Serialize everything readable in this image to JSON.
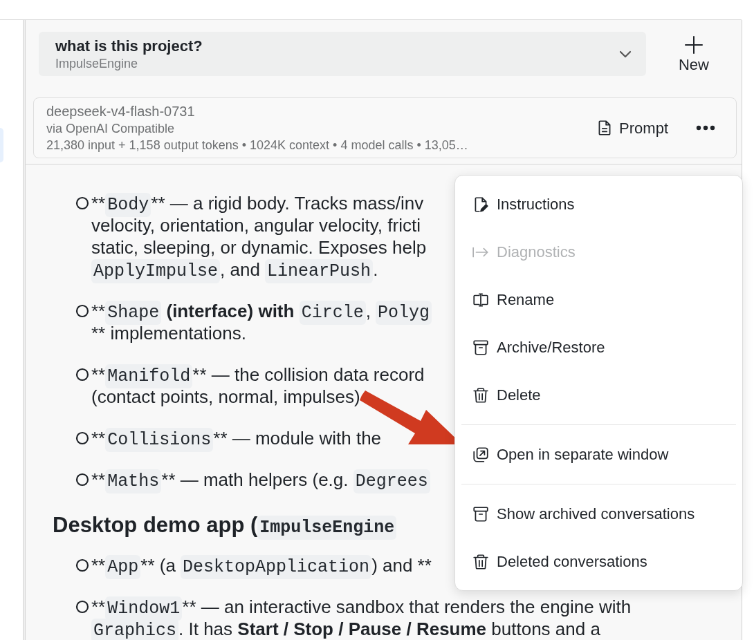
{
  "header": {
    "title": "what is this project?",
    "subtitle": "ImpulseEngine",
    "new_button": "New"
  },
  "model_card": {
    "model": "deepseek-v4-flash-0731",
    "provider": "via OpenAI Compatible",
    "stats": "21,380 input + 1,158 output tokens • 1024K context • 4 model calls • 13,05…",
    "prompt_button": "Prompt"
  },
  "content": [
    {
      "kind": "item",
      "lines": [
        [
          {
            "kind": "text",
            "text": "**"
          },
          {
            "kind": "code",
            "text": "Body"
          },
          {
            "kind": "text",
            "text": "** — a rigid body. Tracks mass/inv"
          }
        ],
        [
          {
            "kind": "text",
            "text": "velocity, orientation, angular velocity, fricti"
          }
        ],
        [
          {
            "kind": "text",
            "text": "static, sleeping, or dynamic. Exposes help"
          }
        ],
        [
          {
            "kind": "code",
            "text": "ApplyImpulse"
          },
          {
            "kind": "text",
            "text": ", and "
          },
          {
            "kind": "code",
            "text": "LinearPush"
          },
          {
            "kind": "text",
            "text": "."
          }
        ]
      ]
    },
    {
      "kind": "item",
      "lines": [
        [
          {
            "kind": "text",
            "text": "**"
          },
          {
            "kind": "code",
            "text": "Shape"
          },
          {
            "kind": "bold",
            "text": " (interface) with "
          },
          {
            "kind": "code",
            "text": "Circle"
          },
          {
            "kind": "text",
            "text": ", "
          },
          {
            "kind": "code",
            "text": "Polyg"
          }
        ],
        [
          {
            "kind": "text",
            "text": "** implementations."
          }
        ]
      ]
    },
    {
      "kind": "item",
      "lines": [
        [
          {
            "kind": "text",
            "text": "**"
          },
          {
            "kind": "code",
            "text": "Manifold"
          },
          {
            "kind": "text",
            "text": "** — the collision data record"
          }
        ],
        [
          {
            "kind": "text",
            "text": "(contact points, normal, impulses)"
          }
        ]
      ]
    },
    {
      "kind": "item",
      "lines": [
        [
          {
            "kind": "text",
            "text": "**"
          },
          {
            "kind": "code",
            "text": "Collisions"
          },
          {
            "kind": "text",
            "text": "** — module with the"
          }
        ]
      ]
    },
    {
      "kind": "item",
      "lines": [
        [
          {
            "kind": "text",
            "text": "**"
          },
          {
            "kind": "code",
            "text": "Maths"
          },
          {
            "kind": "text",
            "text": "** — math helpers (e.g. "
          },
          {
            "kind": "code",
            "text": "Degrees"
          }
        ]
      ]
    },
    {
      "kind": "heading",
      "lines": [
        [
          {
            "kind": "text",
            "text": "Desktop demo app ("
          },
          {
            "kind": "code",
            "text": "ImpulseEngine"
          }
        ]
      ]
    },
    {
      "kind": "item",
      "lines": [
        [
          {
            "kind": "text",
            "text": "**"
          },
          {
            "kind": "code",
            "text": "App"
          },
          {
            "kind": "text",
            "text": "** (a "
          },
          {
            "kind": "code",
            "text": "DesktopApplication"
          },
          {
            "kind": "text",
            "text": ") and **"
          }
        ]
      ]
    },
    {
      "kind": "item",
      "lines": [
        [
          {
            "kind": "text",
            "text": "**"
          },
          {
            "kind": "code",
            "text": "Window1"
          },
          {
            "kind": "text",
            "text": "** — an interactive sandbox that renders the engine with"
          }
        ],
        [
          {
            "kind": "code",
            "text": "Graphics"
          },
          {
            "kind": "text",
            "text": ". It has "
          },
          {
            "kind": "bold",
            "text": "Start / Stop / Pause / Resume"
          },
          {
            "kind": "text",
            "text": " buttons and a"
          }
        ]
      ]
    }
  ],
  "menu": {
    "groups": [
      [
        {
          "label": "Instructions",
          "disabled": false
        },
        {
          "label": "Diagnostics",
          "disabled": true
        },
        {
          "label": "Rename",
          "disabled": false
        },
        {
          "label": "Archive/Restore",
          "disabled": false
        },
        {
          "label": "Delete",
          "disabled": false
        }
      ],
      [
        {
          "label": "Open in separate window",
          "disabled": false
        }
      ],
      [
        {
          "label": "Show archived conversations",
          "disabled": false
        },
        {
          "label": "Deleted conversations",
          "disabled": false
        }
      ]
    ]
  }
}
